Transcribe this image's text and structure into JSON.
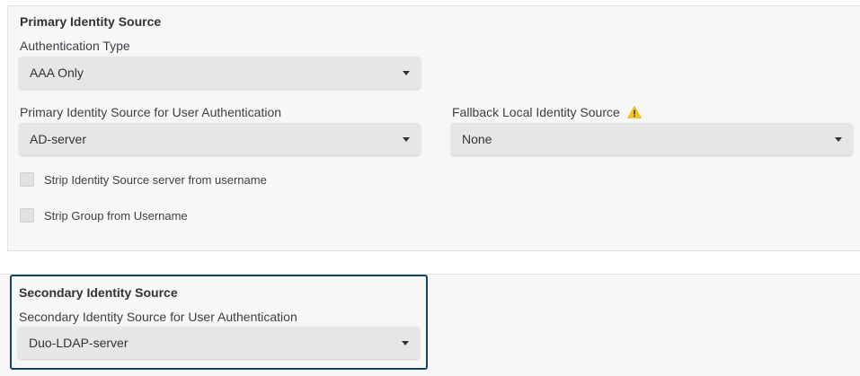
{
  "primary": {
    "title": "Primary Identity Source",
    "auth_type": {
      "label": "Authentication Type",
      "value": "AAA Only"
    },
    "user_auth_source": {
      "label": "Primary Identity Source for User Authentication",
      "value": "AD-server"
    },
    "fallback": {
      "label": "Fallback Local Identity Source",
      "value": "None",
      "icon": "warning-icon"
    },
    "checkboxes": [
      {
        "label": "Strip Identity Source server from username",
        "checked": false
      },
      {
        "label": "Strip Group from Username",
        "checked": false
      }
    ]
  },
  "secondary": {
    "title": "Secondary Identity Source",
    "user_auth_source": {
      "label": "Secondary Identity Source for User Authentication",
      "value": "Duo-LDAP-server"
    }
  },
  "colors": {
    "highlight_border": "#13475e",
    "warning": "#f5c518",
    "panel_bg": "#f7f7f7",
    "select_bg": "#e6e6e6"
  }
}
